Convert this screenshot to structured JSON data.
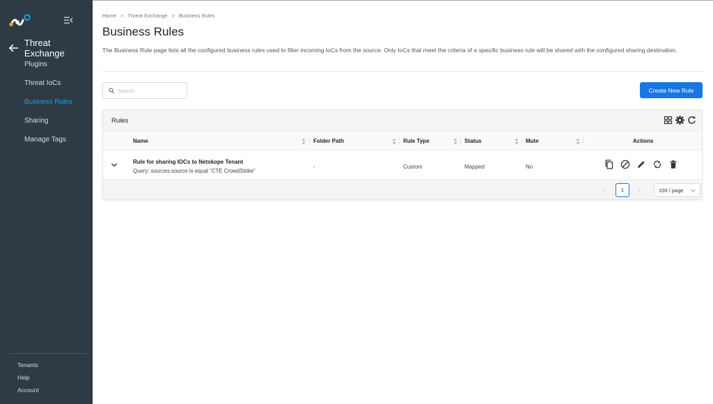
{
  "sidebar": {
    "section_title": "Threat Exchange",
    "items": [
      {
        "label": "Plugins",
        "active": false
      },
      {
        "label": "Threat IoCs",
        "active": false
      },
      {
        "label": "Business Rules",
        "active": true
      },
      {
        "label": "Sharing",
        "active": false
      },
      {
        "label": "Manage Tags",
        "active": false
      }
    ],
    "bottom_items": [
      {
        "label": "Tenants"
      },
      {
        "label": "Help"
      },
      {
        "label": "Account"
      }
    ]
  },
  "breadcrumb": [
    "Home",
    "Threat Exchange",
    "Business Rules"
  ],
  "breadcrumb_separator": ">",
  "page": {
    "title": "Business Rules",
    "description": "The Business Rule page lists all the configured business rules used to filter incoming IoCs from the source. Only IoCs that meet the criteria of a specific business rule will be shared with the configured sharing destination."
  },
  "search": {
    "placeholder": "Search",
    "value": ""
  },
  "create_button_label": "Create New Rule",
  "table": {
    "title": "Rules",
    "columns": [
      "Name",
      "Folder Path",
      "Rule Type",
      "Status",
      "Mute",
      "Actions"
    ],
    "rows": [
      {
        "name": "Rule for sharing IOCs to Netskope Tenant",
        "query": "Query: sources.source Is equal \"CTE CrowdStrike\"",
        "folder_path": "-",
        "rule_type": "Custom",
        "status": "Mapped",
        "mute": "No"
      }
    ]
  },
  "pagination": {
    "current_page": "1",
    "page_size": "100 / page"
  },
  "colors": {
    "sidebar_bg": "#2e3a44",
    "accent": "#1677e5",
    "active_nav": "#1aa3e8"
  }
}
